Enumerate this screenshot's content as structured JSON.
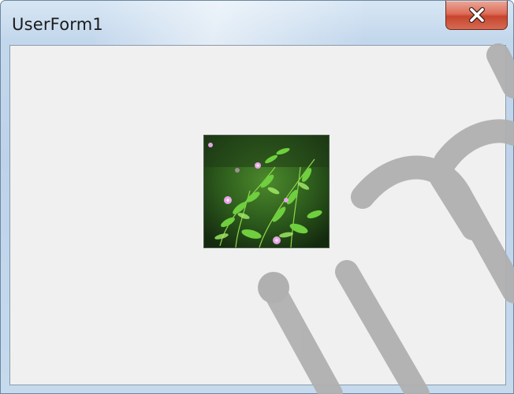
{
  "window": {
    "title": "UserForm1",
    "close_label": "Close",
    "accent_color": "#c7452f"
  },
  "form": {
    "image_description": "green-fern-with-pink-flowers-photo"
  },
  "watermark": {
    "icon": "watermark-logo-icon",
    "color": "#b0b0b0"
  }
}
